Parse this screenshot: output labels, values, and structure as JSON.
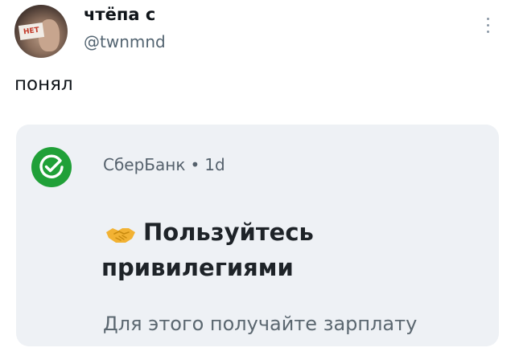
{
  "tweet": {
    "author": {
      "display_name": "чтёпа с",
      "handle": "@twnmnd",
      "avatar_sign_text": "НЕТ"
    },
    "text": "понял",
    "more_icon": "vertical-ellipsis-icon"
  },
  "ad_card": {
    "advertiser": "СберБанк",
    "separator": "•",
    "age": "1d",
    "logo_icon": "sber-logo-icon",
    "headline_emoji": "handshake-icon",
    "headline": "Пользуйтесь привилегиями",
    "body": "Для этого получайте зарплату",
    "colors": {
      "brand_green": "#20a038",
      "card_background": "#eef1f5"
    }
  }
}
